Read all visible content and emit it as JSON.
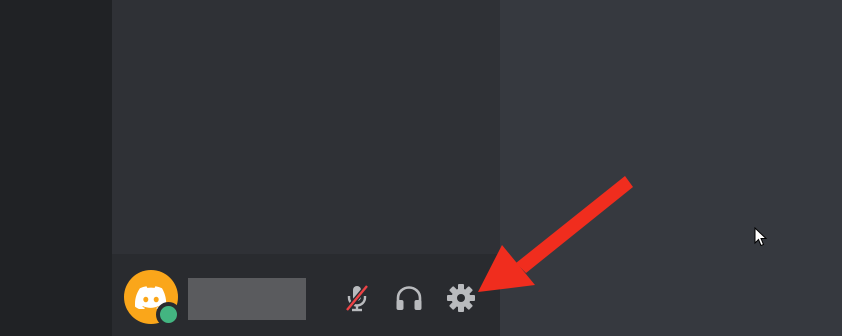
{
  "app": {
    "name": "Discord"
  },
  "user_panel": {
    "avatar_icon": "discord-logo-icon",
    "avatar_color": "#faa61a",
    "status": "online",
    "status_color": "#43b581",
    "username": "",
    "controls": [
      {
        "name": "microphone-muted-icon",
        "state": "muted"
      },
      {
        "name": "headphones-icon",
        "state": "on"
      },
      {
        "name": "gear-icon",
        "state": "default"
      }
    ]
  },
  "annotation": {
    "type": "arrow",
    "color": "#f02d1e",
    "target": "gear-icon"
  },
  "colors": {
    "server_rail": "#202225",
    "channel_sidebar": "#2f3136",
    "user_panel": "#292b2f",
    "main_area": "#36393f",
    "icon_default": "#b9bbbe",
    "muted_slash": "#ed4245"
  }
}
